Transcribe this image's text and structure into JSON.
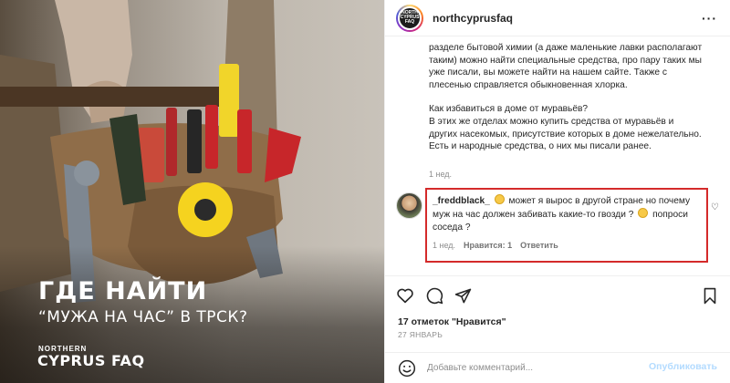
{
  "post_image": {
    "headline": "ГДЕ НАЙТИ",
    "subheadline": "“МУЖА НА ЧАС” В ТРСК?",
    "brand_small": "NORTHERN",
    "brand_big": "CYPRUS FAQ"
  },
  "header": {
    "avatar_line1": "NORTH",
    "avatar_line2": "CYPRUS",
    "avatar_line3": "FAQ",
    "username": "northcyprusfaq",
    "more_label": "···"
  },
  "caption": {
    "paragraph1": "разделе бытовой химии (а даже маленькие лавки располагают таким) можно найти специальные средства, про пару таких мы уже писали, вы можете найти на нашем сайте. Также с плесенью справляется обыкновенная хлорка.",
    "paragraph2_q": "Как избавиться в доме от муравьёв?",
    "paragraph2": "В этих же отделах можно купить средства от муравьёв и других насекомых, присутствие которых в доме нежелательно. Есть и народные средства, о них мы писали ранее.",
    "time": "1 нед."
  },
  "comment": {
    "username": "_freddblack_",
    "text1": "может я вырос в другой стране но почему муж на час должен забивать какие-то гвозди ?",
    "text2": "попроси соседа ?",
    "time": "1 нед.",
    "likes": "Нравится: 1",
    "reply": "Ответить",
    "heart": "♡"
  },
  "post_stats": {
    "likes": "17 отметок \"Нравится\"",
    "date": "27 ЯНВАРЬ"
  },
  "add_comment": {
    "placeholder": "Добавьте комментарий...",
    "publish": "Опубликовать"
  },
  "colors": {
    "highlight_border": "#d42a2a",
    "publish_disabled": "#b3dbff",
    "muted": "#8e8e8e"
  }
}
